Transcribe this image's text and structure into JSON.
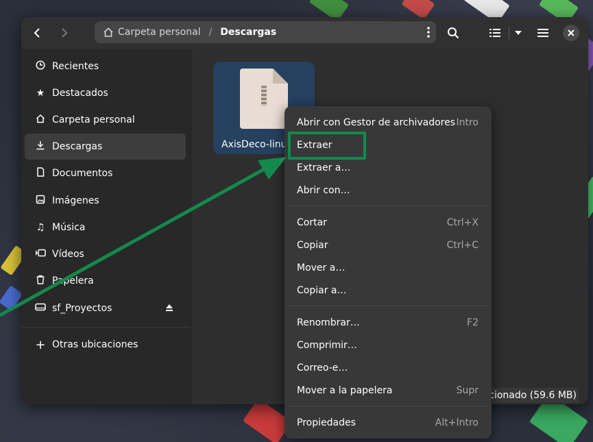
{
  "colors": {
    "accent": "#14894e",
    "selection": "#26405f"
  },
  "header": {
    "back_icon": "chevron-left-icon",
    "forward_icon": "chevron-right-icon",
    "path": [
      "Carpeta personal",
      "Descargas"
    ],
    "path_separator": "/",
    "menu_icon": "vertical-dots-icon",
    "search_icon": "search-icon",
    "view_icon": "list-view-icon",
    "view_dropdown_icon": "chevron-down-icon",
    "main_menu_icon": "hamburger-icon",
    "close_icon": "close-icon"
  },
  "sidebar": {
    "items": [
      {
        "label": "Recientes",
        "icon": "clock-icon"
      },
      {
        "label": "Destacados",
        "icon": "star-icon"
      },
      {
        "label": "Carpeta personal",
        "icon": "home-icon"
      },
      {
        "label": "Descargas",
        "icon": "download-icon",
        "active": true
      },
      {
        "label": "Documentos",
        "icon": "document-icon"
      },
      {
        "label": "Imágenes",
        "icon": "image-icon"
      },
      {
        "label": "Música",
        "icon": "music-icon"
      },
      {
        "label": "Vídeos",
        "icon": "video-icon"
      },
      {
        "label": "Papelera",
        "icon": "trash-icon"
      },
      {
        "label": "sf_Proyectos",
        "icon": "drive-icon",
        "eject_icon": "eject-icon"
      }
    ],
    "other_locations": "Otras ubicaciones"
  },
  "content": {
    "file_name": "AxisDeco-linu",
    "status": "cionado (59.6 MB)"
  },
  "context_menu": {
    "items": [
      {
        "label": "Abrir con Gestor de archivadores",
        "accel": "Intro"
      },
      {
        "label": "Extraer",
        "accel": ""
      },
      {
        "label": "Extraer a…",
        "accel": ""
      },
      {
        "label": "Abrir con…",
        "accel": ""
      },
      {
        "label": "Cortar",
        "accel": "Ctrl+X"
      },
      {
        "label": "Copiar",
        "accel": "Ctrl+C"
      },
      {
        "label": "Mover a…",
        "accel": ""
      },
      {
        "label": "Copiar a…",
        "accel": ""
      },
      {
        "label": "Renombrar…",
        "accel": "F2"
      },
      {
        "label": "Comprimir…",
        "accel": ""
      },
      {
        "label": "Correo-e…",
        "accel": ""
      },
      {
        "label": "Mover a la papelera",
        "accel": "Supr"
      },
      {
        "label": "Propiedades",
        "accel": "Alt+Intro"
      }
    ]
  }
}
